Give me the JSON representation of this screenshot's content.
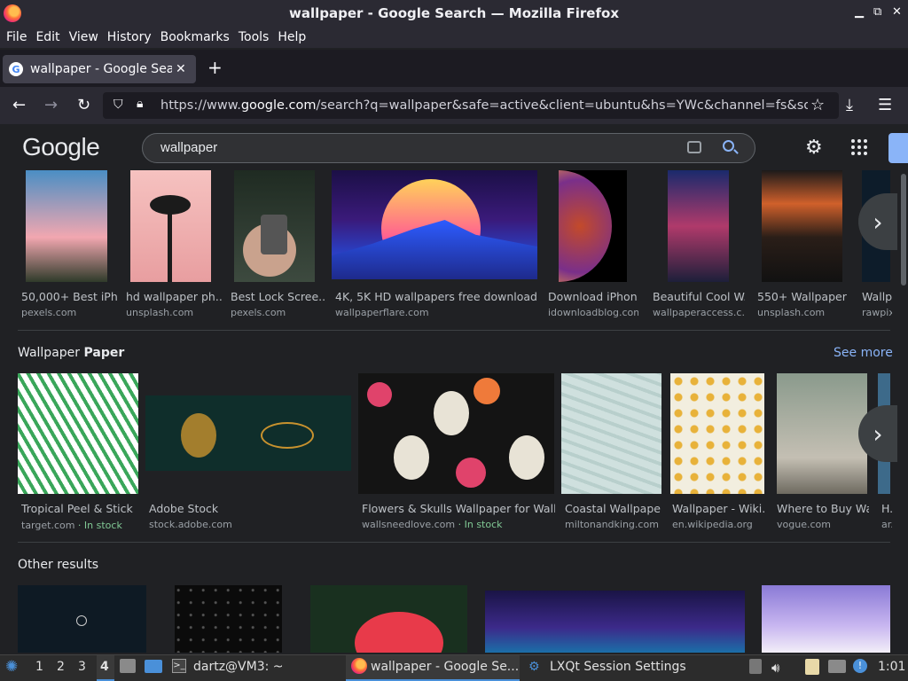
{
  "window": {
    "title": "wallpaper - Google Search — Mozilla Firefox"
  },
  "menu": [
    "File",
    "Edit",
    "View",
    "History",
    "Bookmarks",
    "Tools",
    "Help"
  ],
  "tab": {
    "title": "wallpaper - Google Search",
    "favicon": "G",
    "close": "✕",
    "new_tab": "+"
  },
  "nav": {
    "url_prefix": "https://www.",
    "url_domain": "google.com",
    "url_rest": "/search?q=wallpaper&safe=active&client=ubuntu&hs=YWc&channel=fs&source=lnms&tbm=isch"
  },
  "google": {
    "logo": "Google",
    "query": "wallpaper"
  },
  "row1": [
    {
      "caption": "50,000+ Best iPh...",
      "source": "pexels.com"
    },
    {
      "caption": "hd wallpaper ph...",
      "source": "unsplash.com"
    },
    {
      "caption": "Best Lock Scree...",
      "source": "pexels.com"
    },
    {
      "caption": "4K, 5K HD wallpapers free download ...",
      "source": "wallpaperflare.com"
    },
    {
      "caption": "Download iPhon...",
      "source": "idownloadblog.com"
    },
    {
      "caption": "Beautiful Cool W...",
      "source": "wallpaperaccess.c..."
    },
    {
      "caption": "550+ Wallpaper ...",
      "source": "unsplash.com"
    },
    {
      "caption": "Wallp...",
      "source": "rawpix..."
    }
  ],
  "section2": {
    "title_plain": "Wallpaper ",
    "title_bold": "Paper",
    "see_more": "See more"
  },
  "row2": [
    {
      "caption": "Tropical Peel & Stick ...",
      "source": "target.com",
      "stock": " · In stock"
    },
    {
      "caption": "Adobe Stock",
      "source": "stock.adobe.com",
      "stock": ""
    },
    {
      "caption": "Flowers & Skulls Wallpaper for Walls ...",
      "source": "wallsneedlove.com",
      "stock": " · In stock"
    },
    {
      "caption": "Coastal Wallpape...",
      "source": "miltonandking.com",
      "stock": ""
    },
    {
      "caption": "Wallpaper - Wiki...",
      "source": "en.wikipedia.org",
      "stock": ""
    },
    {
      "caption": "Where to Buy Wa...",
      "source": "vogue.com",
      "stock": ""
    },
    {
      "caption": "H...",
      "source": "ar...",
      "stock": ""
    }
  ],
  "section3": {
    "title": "Other results"
  },
  "taskbar": {
    "workspaces": [
      "1",
      "2",
      "3",
      "4"
    ],
    "terminal": "dartz@VM3: ~",
    "firefox": "wallpaper - Google Se...",
    "lxqt": "LXQt Session Settings",
    "clock": "1:01"
  },
  "colors": {
    "accent": "#8ab4f8",
    "in_stock": "#81c995",
    "background": "#202124"
  }
}
